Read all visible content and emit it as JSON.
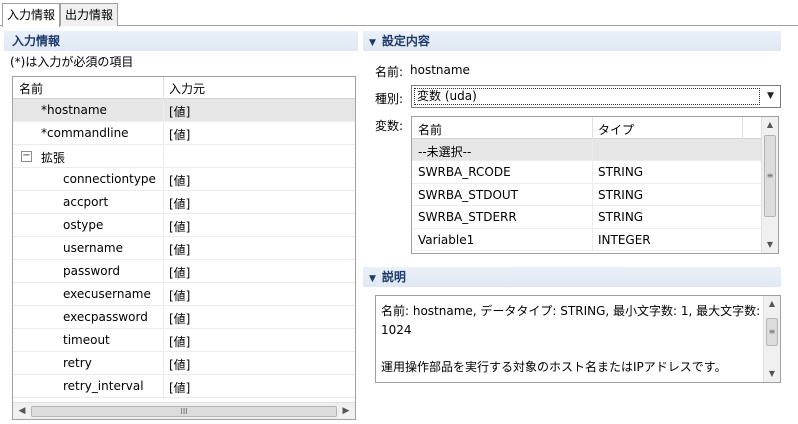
{
  "tabs": [
    {
      "label": "入力情報",
      "active": true
    },
    {
      "label": "出力情報",
      "active": false
    }
  ],
  "left": {
    "section_title": "入力情報",
    "note": "(*)は入力が必須の項目",
    "columns": {
      "name": "名前",
      "source": "入力元"
    },
    "rows": [
      {
        "name": "*hostname",
        "value": "[値]",
        "indent": 1,
        "selected": true
      },
      {
        "name": "*commandline",
        "value": "[値]",
        "indent": 1
      },
      {
        "name": "拡張",
        "value": "",
        "indent": 0,
        "group": true
      },
      {
        "name": "connectiontype",
        "value": "[値]",
        "indent": 2
      },
      {
        "name": "accport",
        "value": "[値]",
        "indent": 2
      },
      {
        "name": "ostype",
        "value": "[値]",
        "indent": 2
      },
      {
        "name": "username",
        "value": "[値]",
        "indent": 2
      },
      {
        "name": "password",
        "value": "[値]",
        "indent": 2
      },
      {
        "name": "execusername",
        "value": "[値]",
        "indent": 2
      },
      {
        "name": "execpassword",
        "value": "[値]",
        "indent": 2
      },
      {
        "name": "timeout",
        "value": "[値]",
        "indent": 2
      },
      {
        "name": "retry",
        "value": "[値]",
        "indent": 2
      },
      {
        "name": "retry_interval",
        "value": "[値]",
        "indent": 2
      }
    ],
    "collapse_glyph": "−",
    "hscroll_grip": "III"
  },
  "settings": {
    "section_title": "設定内容",
    "name_label": "名前:",
    "name_value": "hostname",
    "type_label": "種別:",
    "type_value": "変数 (uda)",
    "var_label": "変数:",
    "var_columns": {
      "name": "名前",
      "type": "タイプ"
    },
    "vars": [
      {
        "name": "--未選択--",
        "type": "",
        "selected": true
      },
      {
        "name": "SWRBA_RCODE",
        "type": "STRING"
      },
      {
        "name": "SWRBA_STDOUT",
        "type": "STRING"
      },
      {
        "name": "SWRBA_STDERR",
        "type": "STRING"
      },
      {
        "name": "Variable1",
        "type": "INTEGER"
      }
    ]
  },
  "description": {
    "section_title": "説明",
    "line1": "名前: hostname, データタイプ: STRING, 最小文字数: 1, 最大文字数: 1024",
    "line2": "運用操作部品を実行する対象のホスト名またはIPアドレスです。"
  },
  "icons": {
    "expand": "triangle-down-icon",
    "scroll_up": "scroll-up-arrow-icon",
    "scroll_down": "scroll-down-arrow-icon",
    "scroll_left": "scroll-left-arrow-icon",
    "scroll_right": "scroll-right-arrow-icon",
    "combo_arrow": "chevron-down-icon"
  }
}
